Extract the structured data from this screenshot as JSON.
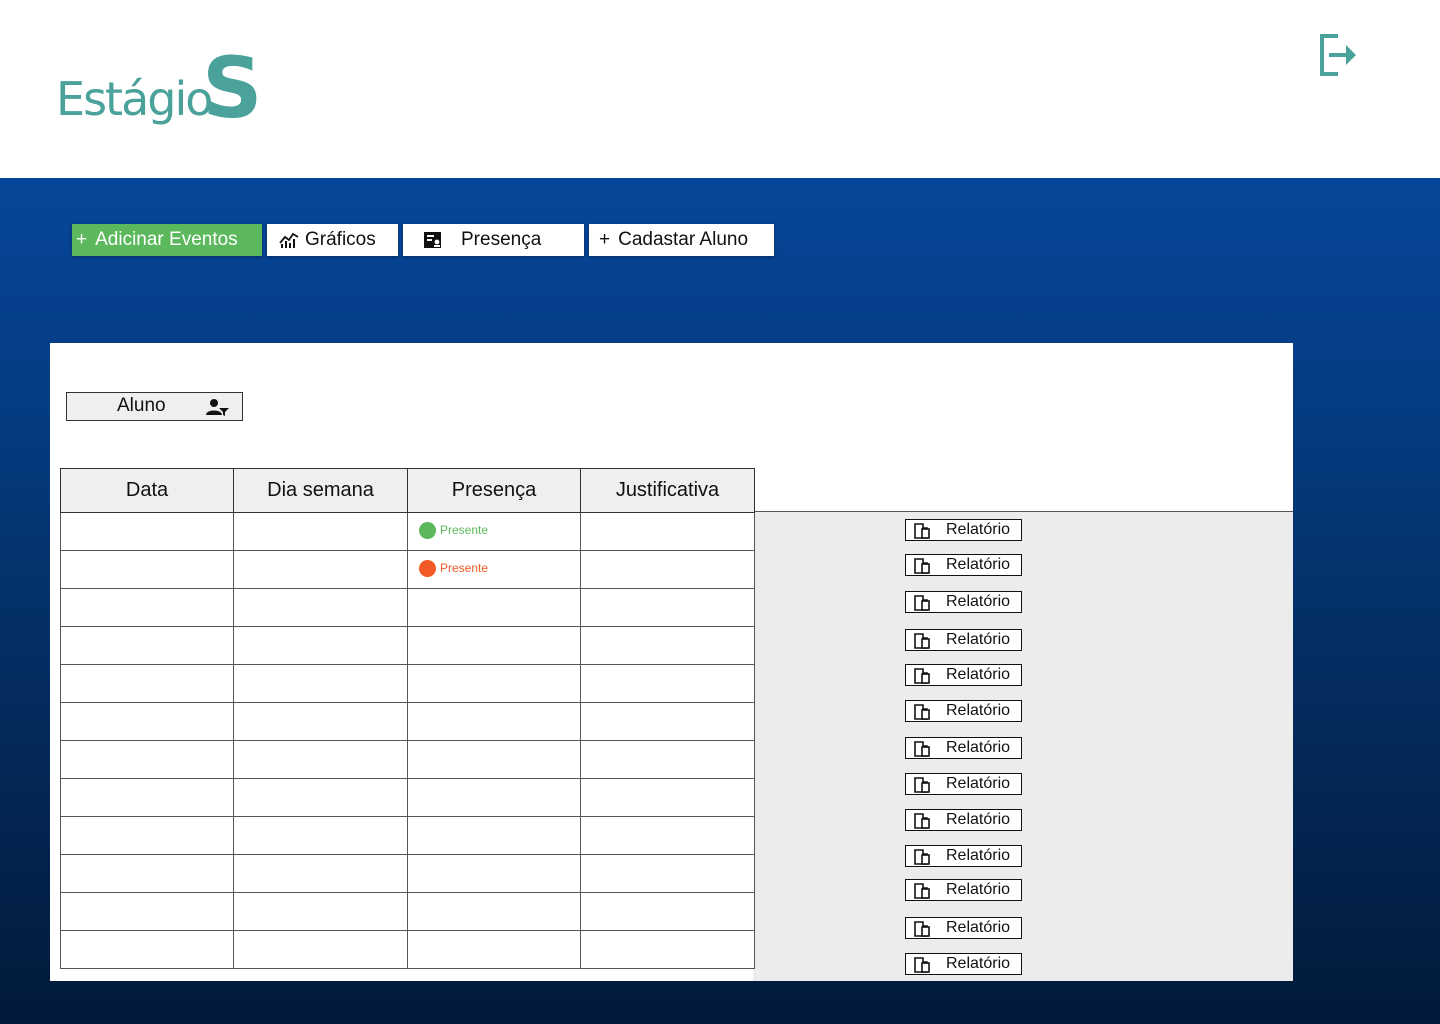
{
  "logo": {
    "text": "Estágio",
    "mark": "S"
  },
  "header": {
    "logout_icon": "logout-icon"
  },
  "colors": {
    "brand": "#4aa29a",
    "accent_green": "#5cb85c",
    "present": "#5cb85c",
    "absent": "#f15a24",
    "nav_dark": "#053a7e"
  },
  "toolbar": {
    "add_events": "Adicinar Eventos",
    "graphs": "Gráficos",
    "presence": "Presença",
    "register_student": "Cadastar Aluno",
    "plus": "+"
  },
  "filter": {
    "student_label": "Aluno",
    "icon": "user-filter-icon"
  },
  "table": {
    "columns": [
      "Data",
      "Dia semana",
      "Presença",
      "Justificativa"
    ],
    "rows": [
      {
        "data": "",
        "dia": "",
        "presenca": "Presente",
        "presenca_color": "#5cb85c",
        "justificativa": ""
      },
      {
        "data": "",
        "dia": "",
        "presenca": "Presente",
        "presenca_color": "#f15a24",
        "justificativa": ""
      },
      {
        "data": "",
        "dia": "",
        "presenca": "",
        "presenca_color": "",
        "justificativa": ""
      },
      {
        "data": "",
        "dia": "",
        "presenca": "",
        "presenca_color": "",
        "justificativa": ""
      },
      {
        "data": "",
        "dia": "",
        "presenca": "",
        "presenca_color": "",
        "justificativa": ""
      },
      {
        "data": "",
        "dia": "",
        "presenca": "",
        "presenca_color": "",
        "justificativa": ""
      },
      {
        "data": "",
        "dia": "",
        "presenca": "",
        "presenca_color": "",
        "justificativa": ""
      },
      {
        "data": "",
        "dia": "",
        "presenca": "",
        "presenca_color": "",
        "justificativa": ""
      },
      {
        "data": "",
        "dia": "",
        "presenca": "",
        "presenca_color": "",
        "justificativa": ""
      },
      {
        "data": "",
        "dia": "",
        "presenca": "",
        "presenca_color": "",
        "justificativa": ""
      },
      {
        "data": "",
        "dia": "",
        "presenca": "",
        "presenca_color": "",
        "justificativa": ""
      },
      {
        "data": "",
        "dia": "",
        "presenca": "",
        "presenca_color": "",
        "justificativa": ""
      }
    ]
  },
  "reports": {
    "label": "Relatório",
    "icon": "document-icon",
    "count": 13
  }
}
